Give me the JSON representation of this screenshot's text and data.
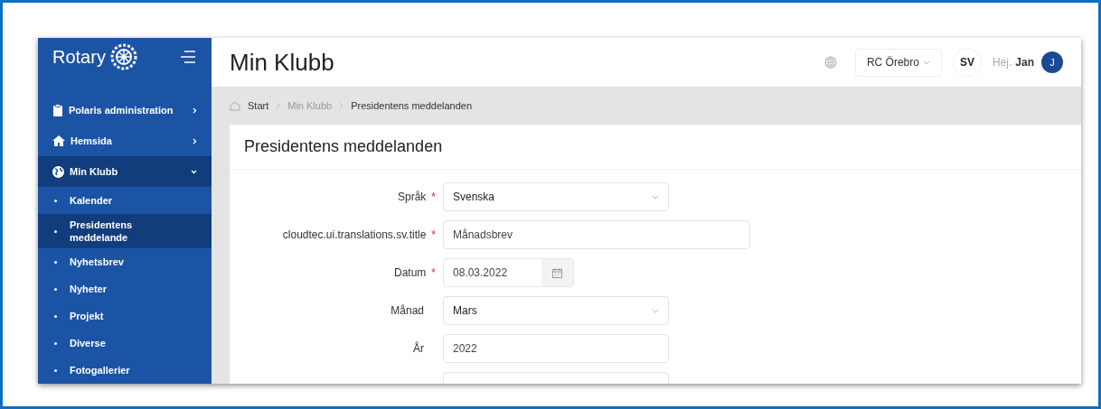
{
  "sidebar": {
    "logo_text": "Rotary",
    "items": [
      {
        "label": "Polaris administration",
        "kind": "admin",
        "expanded": false
      },
      {
        "label": "Hemsida",
        "kind": "home",
        "expanded": false
      },
      {
        "label": "Min Klubb",
        "kind": "club",
        "expanded": true,
        "children": [
          {
            "label": "Kalender",
            "selected": false
          },
          {
            "label": "Presidentens meddelande",
            "selected": true
          },
          {
            "label": "Nyhetsbrev",
            "selected": false
          },
          {
            "label": "Nyheter",
            "selected": false
          },
          {
            "label": "Projekt",
            "selected": false
          },
          {
            "label": "Diverse",
            "selected": false
          },
          {
            "label": "Fotogallerier",
            "selected": false
          }
        ]
      }
    ]
  },
  "header": {
    "title": "Min Klubb",
    "club_select": "RC Örebro",
    "language": "SV",
    "greeting": "Hej.",
    "user_name": "Jan",
    "avatar_initial": "J"
  },
  "breadcrumb": [
    {
      "label": "Start",
      "kind": "link"
    },
    {
      "label": "Min Klubb",
      "kind": "muted"
    },
    {
      "label": "Presidentens meddelanden",
      "kind": "current"
    }
  ],
  "card": {
    "title": "Presidentens meddelanden",
    "fields": [
      {
        "label": "Språk",
        "required_mark": "*",
        "kind": "select",
        "value": "Svenska"
      },
      {
        "label": "cloudtec.ui.translations.sv.title",
        "required_mark": "*",
        "kind": "text",
        "value": "Månadsbrev"
      },
      {
        "label": "Datum",
        "required_mark": "*",
        "kind": "date",
        "value": "08.03.2022"
      },
      {
        "label": "Månad",
        "kind": "select",
        "value": "Mars"
      },
      {
        "label": "År",
        "kind": "text",
        "value": "2022"
      }
    ]
  }
}
